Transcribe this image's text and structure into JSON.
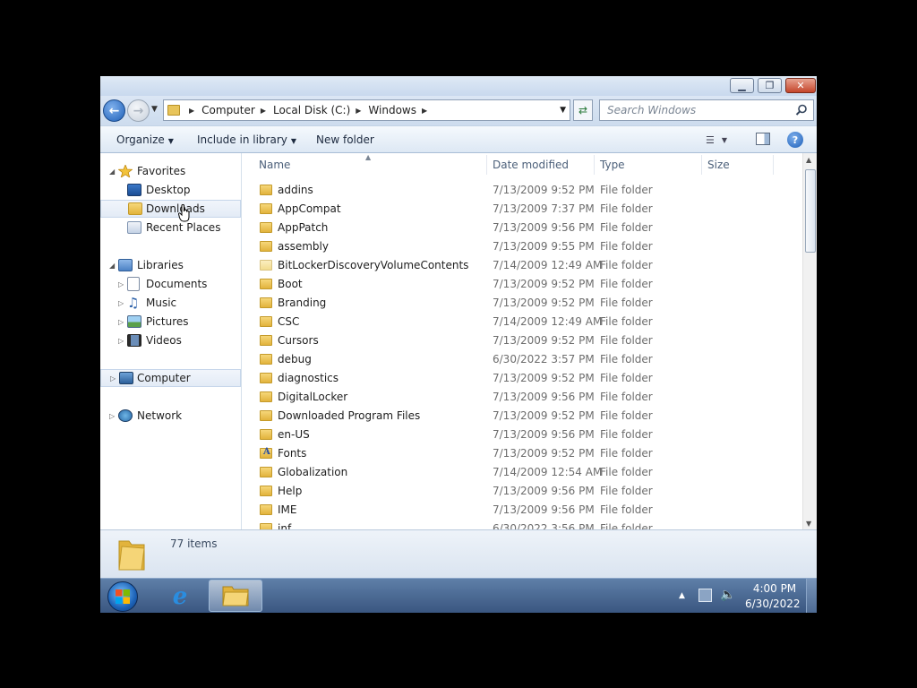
{
  "window": {
    "minimize": "▁",
    "maximize": "❐",
    "close": "✕"
  },
  "address": {
    "breadcrumbs": [
      "Computer",
      "Local Disk (C:)",
      "Windows"
    ],
    "search_placeholder": "Search Windows"
  },
  "toolbar": {
    "organize": "Organize",
    "include_in_library": "Include in library",
    "new_folder": "New folder",
    "help": "?"
  },
  "nav": {
    "favorites": "Favorites",
    "desktop": "Desktop",
    "downloads": "Downloads",
    "recent_places": "Recent Places",
    "libraries": "Libraries",
    "documents": "Documents",
    "music": "Music",
    "pictures": "Pictures",
    "videos": "Videos",
    "computer": "Computer",
    "network": "Network"
  },
  "columns": {
    "name": "Name",
    "date_modified": "Date modified",
    "type": "Type",
    "size": "Size"
  },
  "files": [
    {
      "name": "addins",
      "date": "7/13/2009 9:52 PM",
      "type": "File folder"
    },
    {
      "name": "AppCompat",
      "date": "7/13/2009 7:37 PM",
      "type": "File folder"
    },
    {
      "name": "AppPatch",
      "date": "7/13/2009 9:56 PM",
      "type": "File folder"
    },
    {
      "name": "assembly",
      "date": "7/13/2009 9:55 PM",
      "type": "File folder"
    },
    {
      "name": "BitLockerDiscoveryVolumeContents",
      "date": "7/14/2009 12:49 AM",
      "type": "File folder"
    },
    {
      "name": "Boot",
      "date": "7/13/2009 9:52 PM",
      "type": "File folder"
    },
    {
      "name": "Branding",
      "date": "7/13/2009 9:52 PM",
      "type": "File folder"
    },
    {
      "name": "CSC",
      "date": "7/14/2009 12:49 AM",
      "type": "File folder"
    },
    {
      "name": "Cursors",
      "date": "7/13/2009 9:52 PM",
      "type": "File folder"
    },
    {
      "name": "debug",
      "date": "6/30/2022 3:57 PM",
      "type": "File folder"
    },
    {
      "name": "diagnostics",
      "date": "7/13/2009 9:52 PM",
      "type": "File folder"
    },
    {
      "name": "DigitalLocker",
      "date": "7/13/2009 9:56 PM",
      "type": "File folder"
    },
    {
      "name": "Downloaded Program Files",
      "date": "7/13/2009 9:52 PM",
      "type": "File folder"
    },
    {
      "name": "en-US",
      "date": "7/13/2009 9:56 PM",
      "type": "File folder"
    },
    {
      "name": "Fonts",
      "date": "7/13/2009 9:52 PM",
      "type": "File folder"
    },
    {
      "name": "Globalization",
      "date": "7/14/2009 12:54 AM",
      "type": "File folder"
    },
    {
      "name": "Help",
      "date": "7/13/2009 9:56 PM",
      "type": "File folder"
    },
    {
      "name": "IME",
      "date": "7/13/2009 9:56 PM",
      "type": "File folder"
    },
    {
      "name": "inf",
      "date": "6/30/2022 3:56 PM",
      "type": "File folder"
    }
  ],
  "status": {
    "item_count": "77 items"
  },
  "taskbar": {
    "time": "4:00 PM",
    "date": "6/30/2022"
  },
  "colors": {
    "folder": "#e8c45a",
    "accent": "#1d5fb8"
  }
}
